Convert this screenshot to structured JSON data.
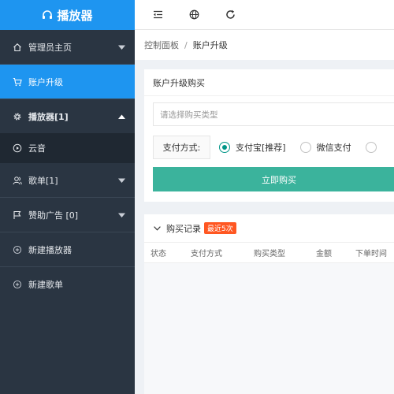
{
  "app": {
    "title": "播放器"
  },
  "sidebar": {
    "items": [
      {
        "label": "管理员主页",
        "icon": "home-icon",
        "caret": "down"
      },
      {
        "label": "账户升级",
        "icon": "cart-icon",
        "active": true
      },
      {
        "label": "播放器[1]",
        "icon": "gear-icon",
        "caret": "up",
        "bold": true
      },
      {
        "label": "云音",
        "icon": "play-circle-icon",
        "sub": true
      },
      {
        "label": "歌单[1]",
        "icon": "user-group-icon",
        "caret": "down"
      },
      {
        "label": "赞助广告 [0]",
        "icon": "flag-icon",
        "caret": "down"
      },
      {
        "label": "新建播放器",
        "icon": "add-circle-icon"
      },
      {
        "label": "新建歌单",
        "icon": "add-circle-icon"
      }
    ]
  },
  "header": {
    "tools": [
      "menu-fold-icon",
      "globe-icon",
      "refresh-icon"
    ]
  },
  "breadcrumb": {
    "root": "控制面板",
    "separator": "/",
    "current": "账户升级"
  },
  "purchase": {
    "title": "账户升级购买",
    "select_placeholder": "请选择购买类型",
    "pay_label": "支付方式:",
    "methods": [
      {
        "label": "支付宝[推荐]",
        "checked": true
      },
      {
        "label": "微信支付",
        "checked": false
      },
      {
        "label": "",
        "checked": false
      }
    ],
    "submit_label": "立即购买"
  },
  "records": {
    "title": "购买记录",
    "badge": "最近5次",
    "columns": [
      "状态",
      "支付方式",
      "购买类型",
      "金额",
      "下单时间"
    ]
  },
  "colors": {
    "accent": "#1e95f0",
    "primary_button": "#3bb39c",
    "sidebar_bg": "#2a3542",
    "badge": "#ff5722"
  }
}
